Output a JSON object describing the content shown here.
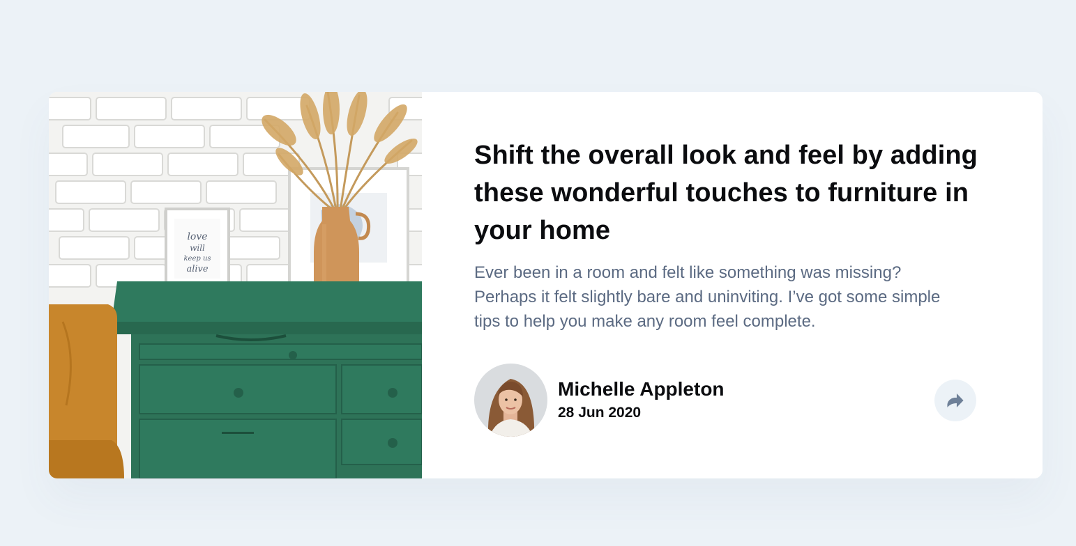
{
  "article": {
    "title": "Shift the overall look and feel by adding these wonderful touches to furniture in your home",
    "excerpt": "Ever been in a room and felt like something was missing? Perhaps it felt slightly bare and uninviting. I’ve got some simple tips to help you make any room feel complete.",
    "image_icon": "drawers-photo",
    "frame_text": "love will keep us alive"
  },
  "author": {
    "name": "Michelle Appleton",
    "date": "28 Jun 2020",
    "avatar_icon": "avatar-photo"
  },
  "share": {
    "icon": "share-icon"
  },
  "colors": {
    "background": "#ecf2f7",
    "card": "#ffffff",
    "heading": "#0b0c0f",
    "body_text": "#5b6a82",
    "share_icon": "#6e8098",
    "share_bg": "#ecf2f7",
    "dresser": "#2f7a5e"
  }
}
